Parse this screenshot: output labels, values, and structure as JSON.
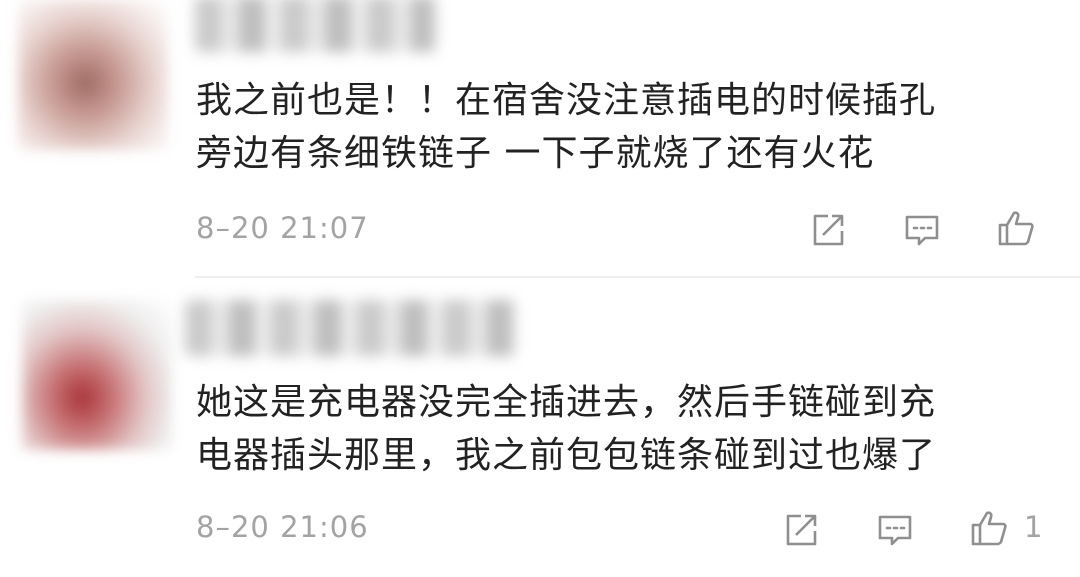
{
  "comments": [
    {
      "text_lines": [
        "我之前也是！！在宿舍没注意插电的时候插孔",
        "旁边有条细铁链子 一下子就烧了还有火花"
      ],
      "time": "8–20 21:07",
      "like_count": null,
      "avatar": "blurred-avatar",
      "username": "blurred"
    },
    {
      "text_lines": [
        "她这是充电器没完全插进去，然后手链碰到充",
        "电器插头那里，我之前包包链条碰到过也爆了"
      ],
      "time": "8–20 21:06",
      "like_count": "1",
      "avatar": "blurred-avatar",
      "username": "blurred"
    }
  ],
  "icons": {
    "share": "share-icon",
    "reply": "reply-icon",
    "like": "thumbs-up-icon"
  },
  "colors": {
    "text": "#222222",
    "meta": "#a3a3a3",
    "divider": "#eeeeee"
  }
}
